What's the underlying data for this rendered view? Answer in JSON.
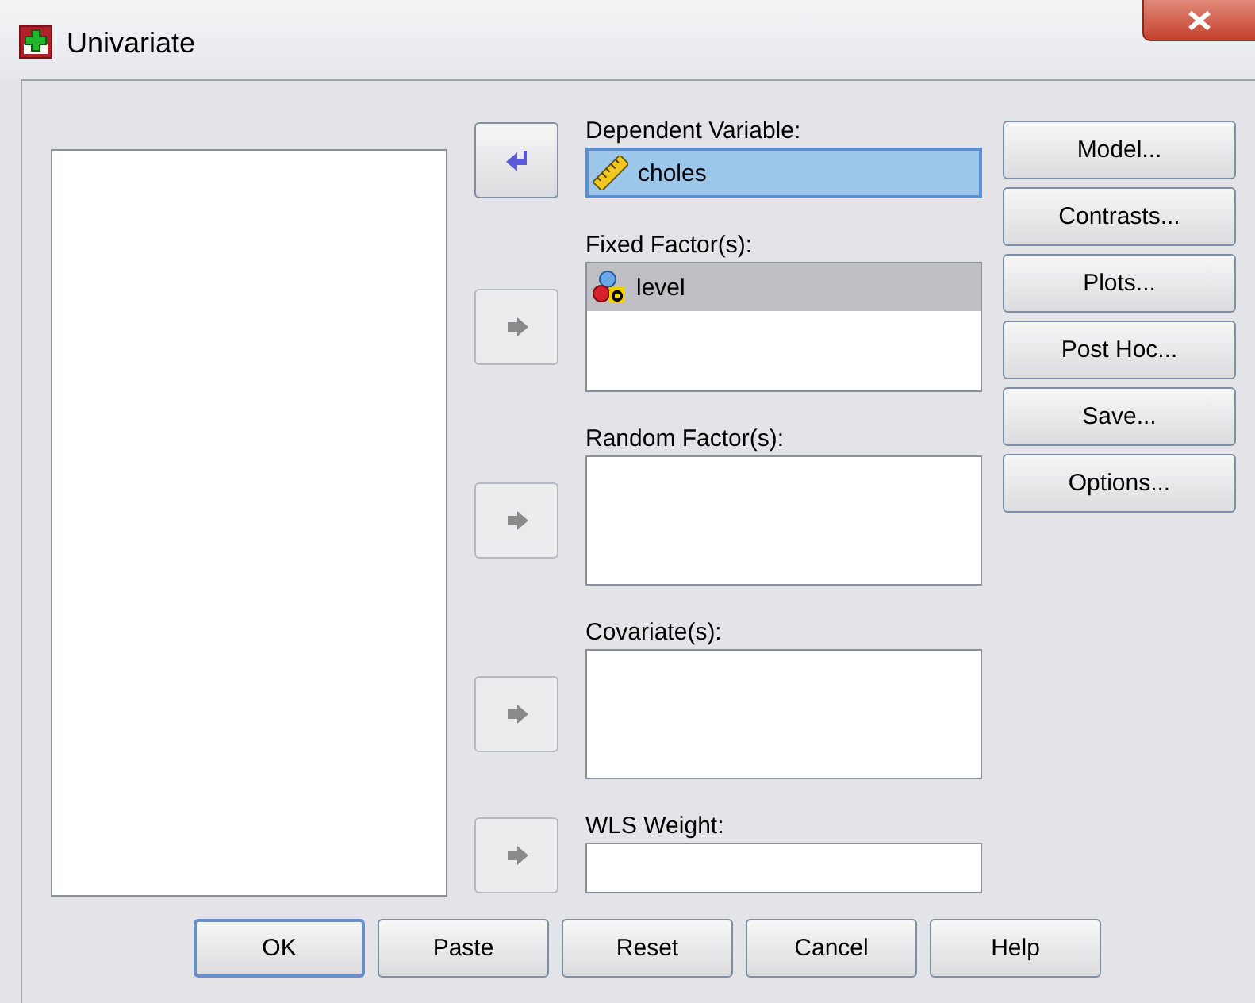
{
  "window": {
    "title": "Univariate"
  },
  "targets": [
    {
      "label": "Dependent Variable:",
      "kind": "field",
      "focused": true,
      "arrow": {
        "kind": "left",
        "disabled": false
      },
      "items": [
        {
          "name": "choles",
          "kind": "scale"
        }
      ]
    },
    {
      "label": "Fixed Factor(s):",
      "kind": "list",
      "focused": false,
      "arrow": {
        "kind": "right",
        "disabled": true
      },
      "items": [
        {
          "name": "level",
          "kind": "nominal",
          "selected": true
        }
      ]
    },
    {
      "label": "Random Factor(s):",
      "kind": "list",
      "focused": false,
      "arrow": {
        "kind": "right",
        "disabled": true
      }
    },
    {
      "label": "Covariate(s):",
      "kind": "list",
      "focused": false,
      "arrow": {
        "kind": "right",
        "disabled": true
      }
    },
    {
      "label": "WLS Weight:",
      "kind": "field",
      "focused": false,
      "arrow": {
        "kind": "right",
        "disabled": true
      }
    }
  ],
  "side_buttons": [
    {
      "label": "Model..."
    },
    {
      "label": "Contrasts..."
    },
    {
      "label": "Plots..."
    },
    {
      "label": "Post Hoc..."
    },
    {
      "label": "Save..."
    },
    {
      "label": "Options..."
    }
  ],
  "bottom_buttons": [
    {
      "label": "OK",
      "default": true
    },
    {
      "label": "Paste",
      "default": false
    },
    {
      "label": "Reset",
      "default": false
    },
    {
      "label": "Cancel",
      "default": false
    },
    {
      "label": "Help",
      "default": false
    }
  ]
}
